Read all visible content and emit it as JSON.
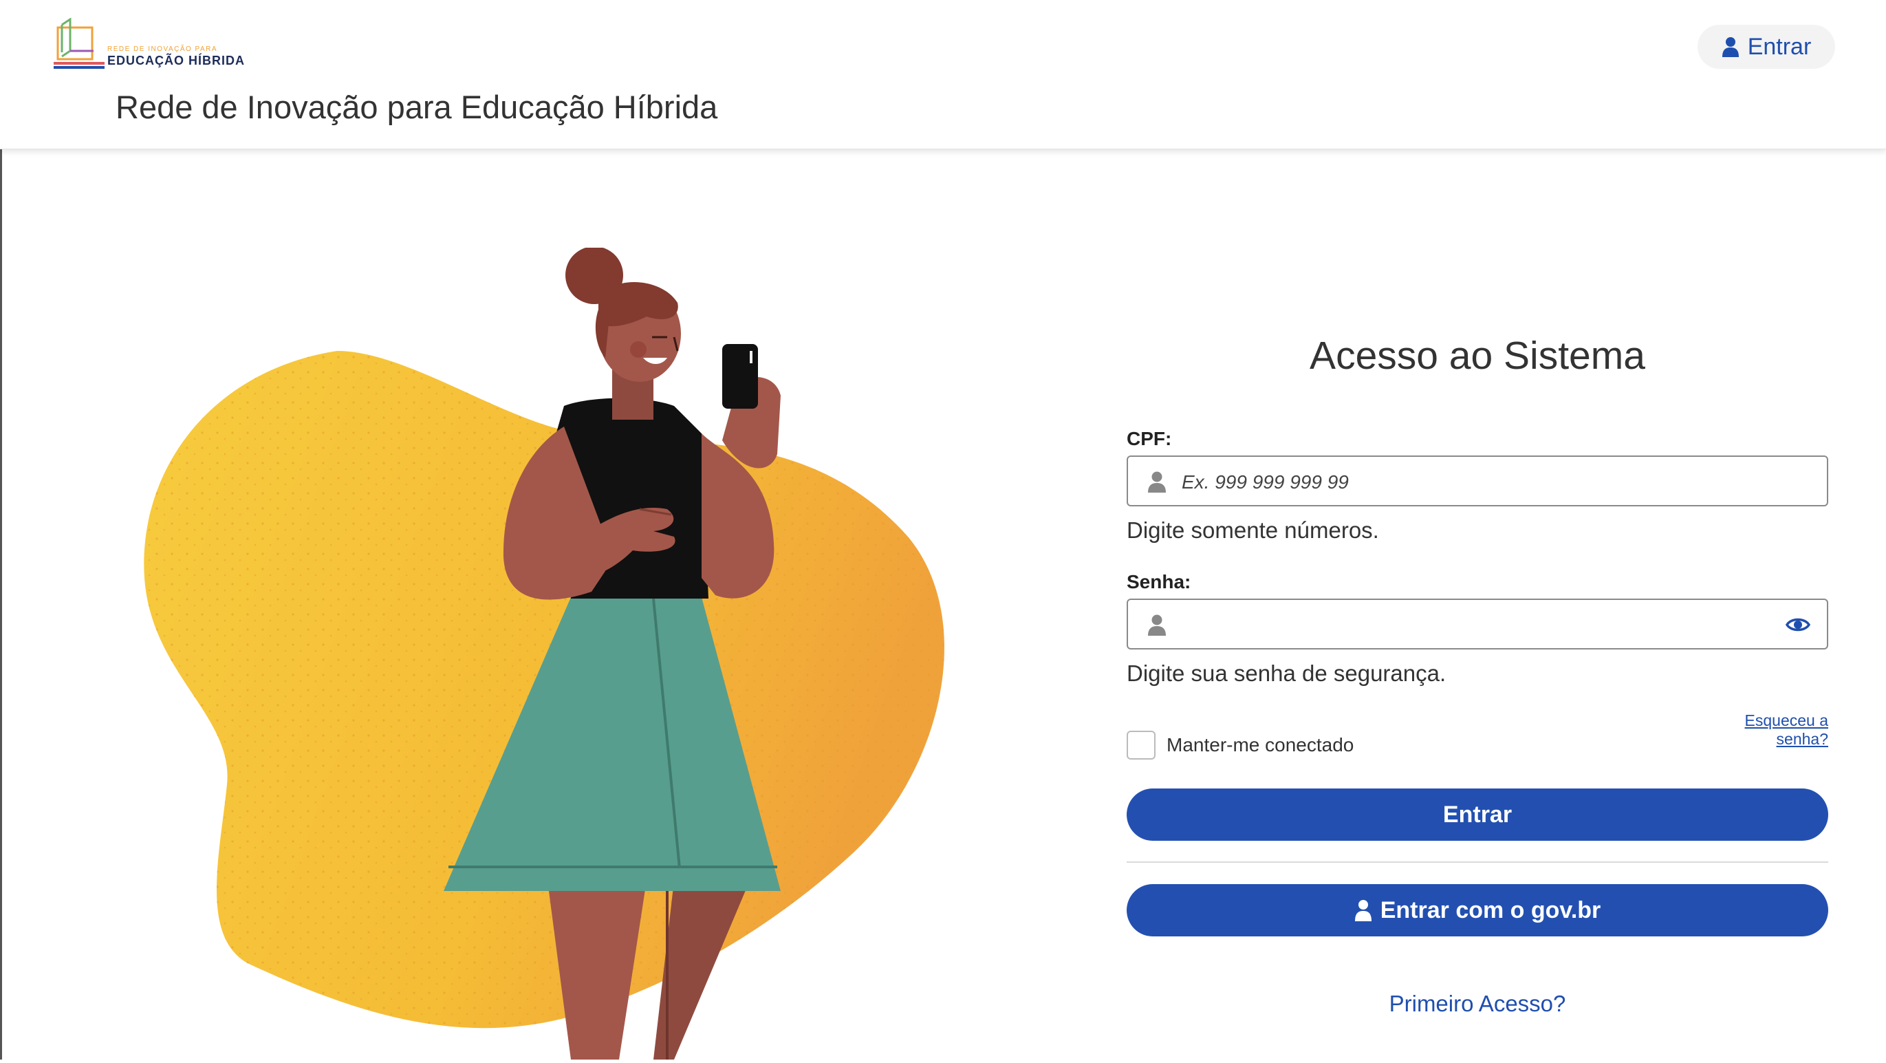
{
  "header": {
    "logo_small_text": "REDE DE INOVAÇÃO PARA",
    "logo_main_text": "EDUCAÇÃO HÍBRIDA",
    "site_title": "Rede de Inovação para Educação Híbrida",
    "login_button_label": "Entrar",
    "login_button_icon": "user-icon"
  },
  "login_form": {
    "title": "Acesso ao Sistema",
    "cpf": {
      "label": "CPF:",
      "placeholder": "Ex. 999 999 999 99",
      "value": "",
      "hint": "Digite somente números.",
      "icon": "user-icon"
    },
    "password": {
      "label": "Senha:",
      "placeholder": "",
      "value": "",
      "hint": "Digite sua senha de segurança.",
      "icon": "user-icon",
      "toggle_icon": "eye-icon"
    },
    "forgot_password": "Esqueceu a senha?",
    "remember_me": {
      "label": "Manter-me conectado",
      "checked": false
    },
    "submit_label": "Entrar",
    "govbr_label": "Entrar com o gov.br",
    "first_access": "Primeiro Acesso?"
  },
  "colors": {
    "primary": "#2350b0",
    "link": "#1f4fae",
    "blob_yellow": "#f6c437",
    "blob_orange": "#f0a23a",
    "skirt_green": "#579e8f",
    "skin": "#a3574a",
    "hair": "#833a2f"
  }
}
